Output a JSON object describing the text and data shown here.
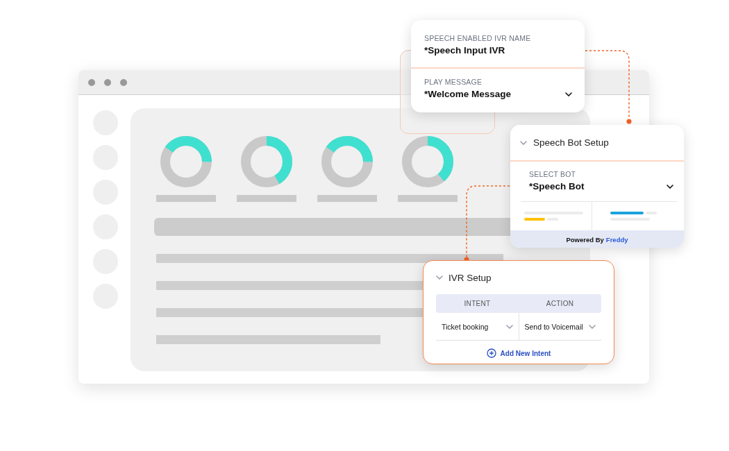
{
  "ivr_name": {
    "label": "SPEECH ENABLED IVR NAME",
    "value": "*Speech Input IVR"
  },
  "play_message": {
    "label": "PLAY MESSAGE",
    "value": "*Welcome Message"
  },
  "speech_bot": {
    "title": "Speech Bot Setup",
    "label": "SELECT BOT",
    "value": "*Speech Bot",
    "footer": "Powered By",
    "brand": "Freddy"
  },
  "ivr_setup": {
    "title": "IVR Setup",
    "columns": [
      "INTENT",
      "ACTION"
    ],
    "rows": [
      {
        "intent": "Ticket booking",
        "action": "Send to Voicemail"
      }
    ],
    "add_button": "Add New Intent"
  }
}
